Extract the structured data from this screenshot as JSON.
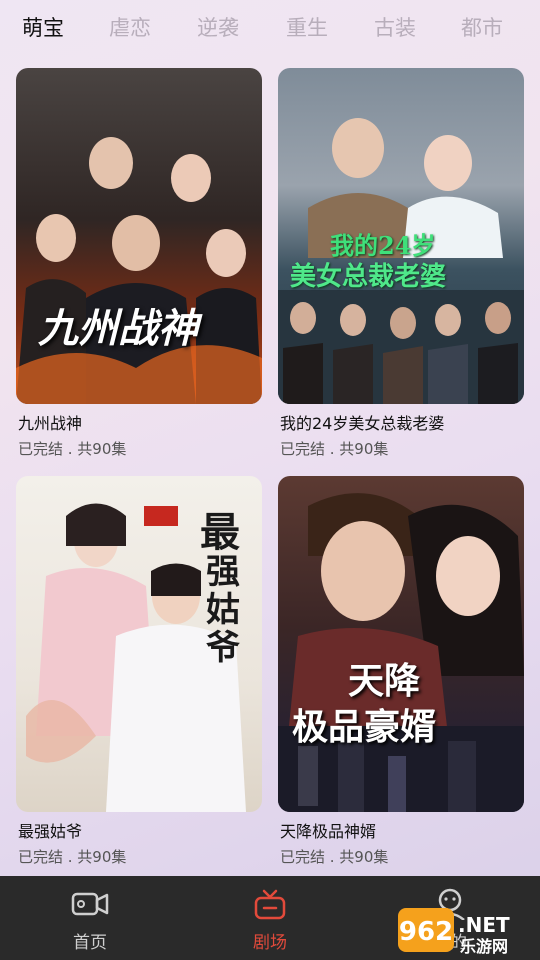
{
  "tabs": [
    {
      "label": "萌宝",
      "active": true
    },
    {
      "label": "虐恋",
      "active": false
    },
    {
      "label": "逆袭",
      "active": false
    },
    {
      "label": "重生",
      "active": false
    },
    {
      "label": "古装",
      "active": false
    },
    {
      "label": "都市",
      "active": false
    }
  ],
  "dramas": [
    {
      "title": "九州战神",
      "status": "已完结 . 共90集",
      "poster_text": [
        "九州战神"
      ],
      "poster_colors": [
        "#3a2a25",
        "#b3461e"
      ]
    },
    {
      "title": "我的24岁美女总裁老婆",
      "status": "已完结 . 共90集",
      "poster_text": [
        "我的24岁",
        "美女总裁老婆"
      ],
      "poster_colors": [
        "#6f7c8a",
        "#2e3b4a"
      ]
    },
    {
      "title": "最强姑爷",
      "status": "已完结 . 共90集",
      "poster_text": [
        "最",
        "强",
        "姑",
        "爷"
      ],
      "poster_colors": [
        "#f0ece4",
        "#d8cfc2"
      ]
    },
    {
      "title": "天降极品神婿",
      "status": "已完结 . 共90集",
      "poster_text": [
        "天降",
        "极品豪婿"
      ],
      "poster_colors": [
        "#4a2b2a",
        "#1e1d2b"
      ]
    }
  ],
  "bottom_nav": [
    {
      "label": "首页",
      "icon": "video-camera-icon",
      "active": false
    },
    {
      "label": "剧场",
      "icon": "tv-icon",
      "active": true
    },
    {
      "label": "我的",
      "icon": "user-icon",
      "active": false
    }
  ],
  "watermark": {
    "line1": "962.NET",
    "line2": "乐游网"
  },
  "colors": {
    "accent": "#e24a3b",
    "nav_bg": "#2a2a2a",
    "tab_active": "#111111",
    "tab_inactive": "#b8aebb"
  }
}
